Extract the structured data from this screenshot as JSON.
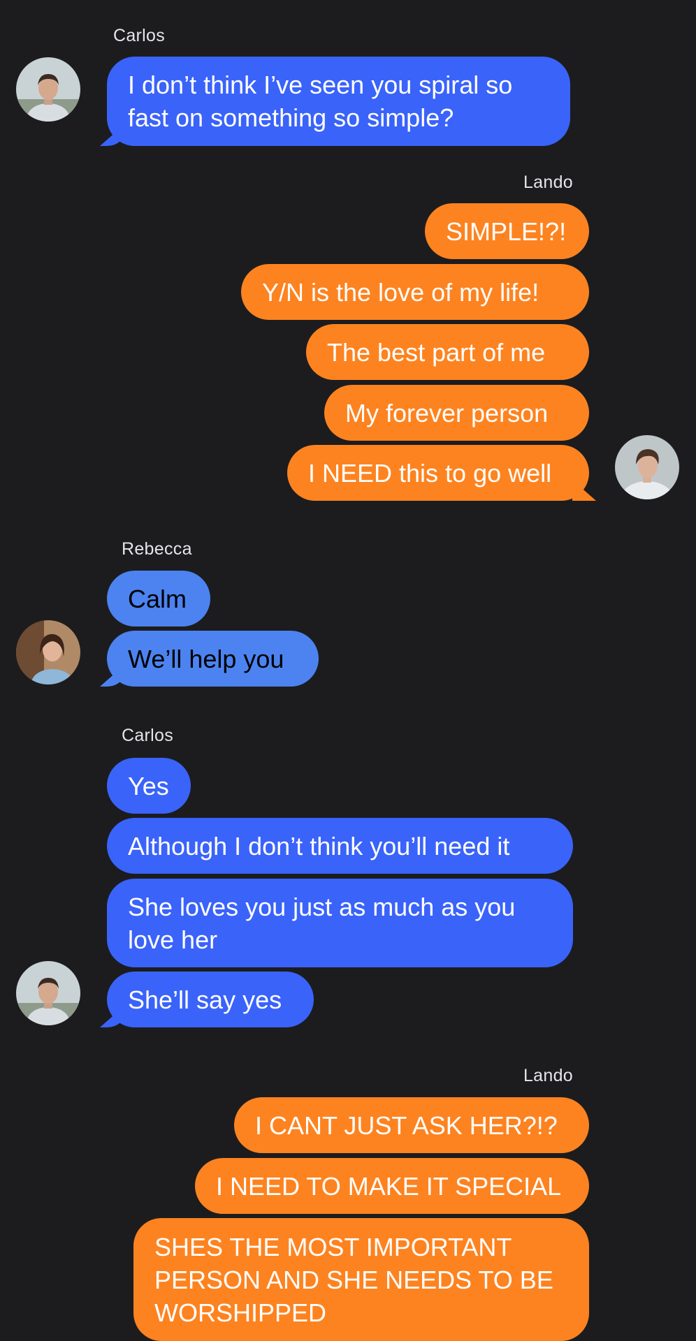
{
  "conversation": {
    "groups": [
      {
        "sender": "Carlos",
        "messages": [
          "I don’t think I’ve seen you spiral so\nfast on something so simple?"
        ]
      },
      {
        "sender": "Lando",
        "messages": [
          "SIMPLE!?!",
          "Y/N is the love of my life!",
          "The best part of me",
          "My forever person",
          "I NEED this to go well"
        ]
      },
      {
        "sender": "Rebecca",
        "messages": [
          "Calm",
          "We’ll help you"
        ]
      },
      {
        "sender": "Carlos",
        "messages": [
          "Yes",
          "Although I don’t think you’ll need it",
          "She loves you just as much as you\nlove her",
          "She’ll say yes"
        ]
      },
      {
        "sender": "Lando",
        "messages": [
          "I CANT JUST ASK HER?!?",
          "I NEED TO MAKE IT SPECIAL",
          "SHES THE MOST IMPORTANT\nPERSON AND SHE NEEDS TO BE\nWORSHIPPED"
        ]
      }
    ]
  },
  "colors": {
    "background": "#1c1c1e",
    "carlos_bubble": "#3a63fa",
    "rebecca_bubble": "#4c83f0",
    "lando_bubble": "#fd8320"
  },
  "avatars": {
    "carlos": "carlos-avatar",
    "lando": "lando-avatar",
    "rebecca": "rebecca-avatar"
  }
}
